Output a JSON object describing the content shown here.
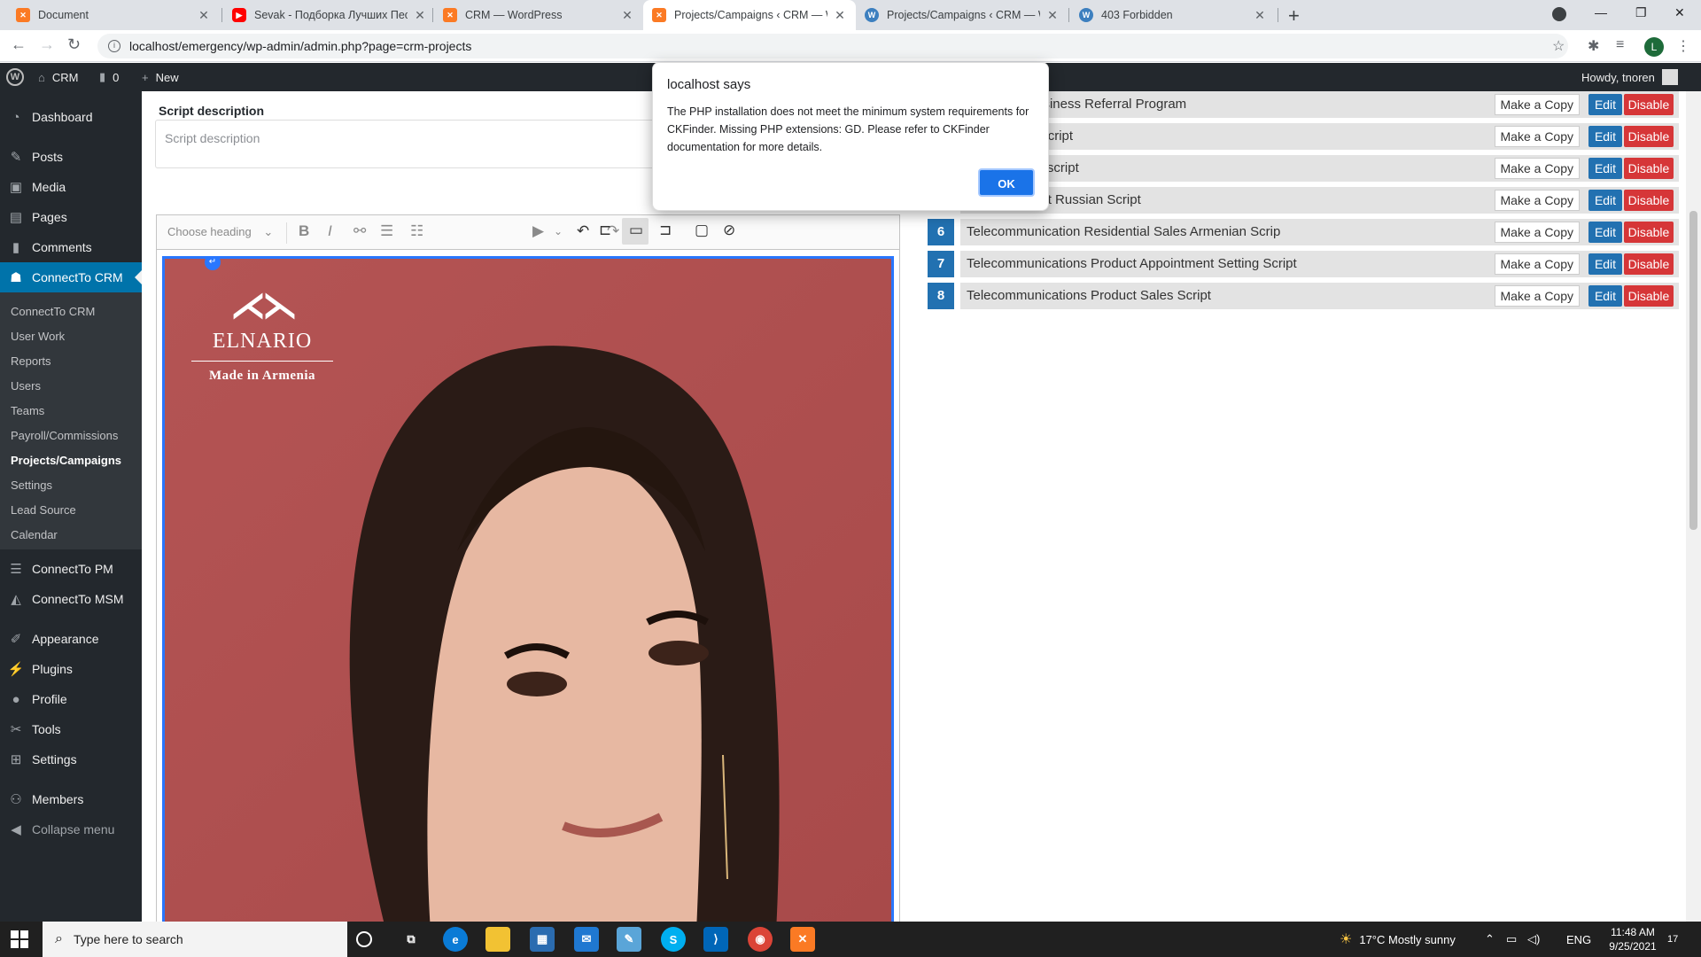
{
  "browser": {
    "tabs": [
      {
        "title": "Document",
        "favicon": "xampp-icon"
      },
      {
        "title": "Sevak - Подборка Лучших Песе",
        "favicon": "youtube-icon"
      },
      {
        "title": "CRM — WordPress",
        "favicon": "xampp-icon"
      },
      {
        "title": "Projects/Campaigns ‹ CRM — W",
        "favicon": "xampp-icon"
      },
      {
        "title": "Projects/Campaigns ‹ CRM — W",
        "favicon": "wordpress-icon"
      },
      {
        "title": "403 Forbidden",
        "favicon": "wordpress-icon"
      }
    ],
    "active_tab_index": 3,
    "url": "localhost/emergency/wp-admin/admin.php?page=crm-projects",
    "profile_initial": "L"
  },
  "adminbar": {
    "site_name": "CRM",
    "comments_count": "0",
    "new_label": "New",
    "greeting": "Howdy, tnoren"
  },
  "sidebar": {
    "items_top": [
      {
        "label": "Dashboard",
        "icon": "dashboard-icon"
      },
      {
        "label": "Posts",
        "icon": "pin-icon"
      },
      {
        "label": "Media",
        "icon": "media-icon"
      },
      {
        "label": "Pages",
        "icon": "page-icon"
      },
      {
        "label": "Comments",
        "icon": "comment-icon"
      },
      {
        "label": "ConnectTo CRM",
        "icon": "crm-icon"
      }
    ],
    "submenu": [
      {
        "label": "ConnectTo CRM"
      },
      {
        "label": "User Work"
      },
      {
        "label": "Reports"
      },
      {
        "label": "Users"
      },
      {
        "label": "Teams"
      },
      {
        "label": "Payroll/Commissions"
      },
      {
        "label": "Projects/Campaigns"
      },
      {
        "label": "Settings"
      },
      {
        "label": "Lead Source"
      },
      {
        "label": "Calendar"
      }
    ],
    "items_bottom": [
      {
        "label": "ConnectTo PM",
        "icon": "menu-icon"
      },
      {
        "label": "ConnectTo MSM",
        "icon": "graduation-icon"
      },
      {
        "label": "Appearance",
        "icon": "brush-icon"
      },
      {
        "label": "Plugins",
        "icon": "plugin-icon"
      },
      {
        "label": "Profile",
        "icon": "user-icon"
      },
      {
        "label": "Tools",
        "icon": "wrench-icon"
      },
      {
        "label": "Settings",
        "icon": "settings-icon"
      },
      {
        "label": "Members",
        "icon": "group-icon"
      },
      {
        "label": "Collapse menu",
        "icon": "collapse-icon"
      }
    ]
  },
  "form": {
    "script_description_label": "Script description",
    "script_description_placeholder": "Script description",
    "heading_select": "Choose heading"
  },
  "image": {
    "logo_name": "ELNARIO",
    "logo_tagline": "Made in Armenia"
  },
  "scripts": [
    {
      "num": "",
      "name": "dential To Business Referral Program"
    },
    {
      "num": "",
      "name": "evelopment Script"
    },
    {
      "num": "",
      "name": "d Generation script"
    },
    {
      "num": "",
      "name": "aitons Product Russian Script"
    },
    {
      "num": "6",
      "name": "Telecommunication Residential Sales Armenian Scrip"
    },
    {
      "num": "7",
      "name": "Telecommunications Product Appointment Setting Script"
    },
    {
      "num": "8",
      "name": "Telecommunications Product Sales Script"
    }
  ],
  "row_actions": {
    "copy": "Make a Copy",
    "edit": "Edit",
    "disable": "Disable"
  },
  "dialog": {
    "title": "localhost says",
    "message": "The PHP installation does not meet the minimum system requirements for CKFinder. Missing PHP extensions: GD. Please refer to CKFinder documentation for more details.",
    "ok": "OK"
  },
  "taskbar": {
    "search_placeholder": "Type here to search",
    "weather": "17°C  Mostly sunny",
    "language": "ENG",
    "time": "11:48 AM",
    "date": "9/25/2021",
    "notification_count": "17"
  },
  "colors": {
    "wp_blue": "#2271b1",
    "disable_red": "#d63638",
    "admin_dark": "#23282d",
    "dialog_ok": "#1a73e8"
  }
}
